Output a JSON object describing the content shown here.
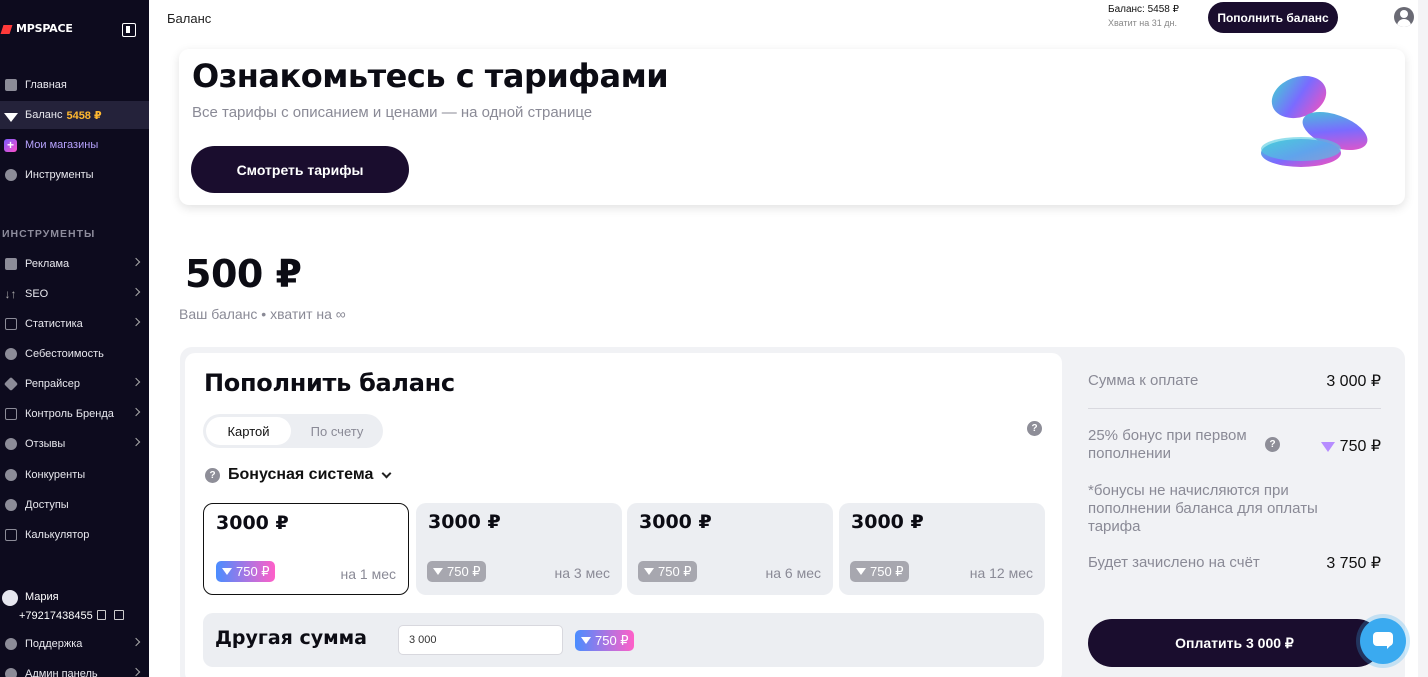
{
  "sidebar": {
    "logo": "MPSPACE",
    "items_top": [
      {
        "label": "Главная",
        "icon": "home-icon"
      },
      {
        "label": "Баланс",
        "value": "5458 ₽",
        "icon": "diamond-icon"
      },
      {
        "label": "Мои магазины",
        "icon": "plus-square-icon"
      },
      {
        "label": "Инструменты",
        "icon": "gear-icon"
      }
    ],
    "section_title": "ИНСТРУМЕНТЫ",
    "tools": [
      {
        "label": "Реклама",
        "icon": "robot-icon"
      },
      {
        "label": "SEO",
        "icon": "sort-icon"
      },
      {
        "label": "Статистика",
        "icon": "chart-icon"
      },
      {
        "label": "Себестоимость",
        "icon": "dollar-icon"
      },
      {
        "label": "Репрайсер",
        "icon": "tag-icon"
      },
      {
        "label": "Контроль Бренда",
        "icon": "building-icon"
      },
      {
        "label": "Отзывы",
        "icon": "chat-bubble-icon"
      },
      {
        "label": "Конкуренты",
        "icon": "shield-icon"
      },
      {
        "label": "Доступы",
        "icon": "user-key-icon"
      },
      {
        "label": "Калькулятор",
        "icon": "calculator-icon"
      }
    ],
    "user": {
      "name": "Мария",
      "phone": "+79217438455"
    },
    "bottom_items": [
      {
        "label": "Поддержка",
        "icon": "help-icon"
      },
      {
        "label": "Админ панель",
        "icon": "admin-icon"
      }
    ]
  },
  "header": {
    "title": "Баланс",
    "balance": "Баланс: 5458 ₽",
    "days": "Хватит на 31 дн.",
    "topup": "Пополнить баланс"
  },
  "promo": {
    "title": "Ознакомьтесь с тарифами",
    "subtitle": "Все тарифы с описанием и ценами — на одной странице",
    "button": "Смотреть тарифы"
  },
  "balance": {
    "amount": "500 ₽",
    "subtitle": "Ваш баланс • хватит на ∞"
  },
  "topup_form": {
    "title": "Пополнить баланс",
    "tabs": [
      "Картой",
      "По счету"
    ],
    "bonus_system": "Бонусная система",
    "plans": [
      {
        "price": "3000 ₽",
        "bonus": "750 ₽",
        "period": "на 1 мес"
      },
      {
        "price": "3000 ₽",
        "bonus": "750 ₽",
        "period": "на 3 мес"
      },
      {
        "price": "3000 ₽",
        "bonus": "750 ₽",
        "period": "на 6 мес"
      },
      {
        "price": "3000 ₽",
        "bonus": "750 ₽",
        "period": "на 12 мес"
      }
    ],
    "other_label": "Другая сумма",
    "other_value": "3 000",
    "other_bonus": "750 ₽"
  },
  "summary": {
    "to_pay_label": "Сумма к оплате",
    "to_pay_value": "3 000 ₽",
    "bonus_label": "25% бонус при первом пополнении",
    "bonus_value": "750 ₽",
    "note": "*бонусы не начисляются при пополнении баланса для оплаты тарифа",
    "credited_label": "Будет зачислено на счёт",
    "credited_value": "3 750 ₽",
    "pay_button": "Оплатить 3 000 ₽"
  },
  "colors": {
    "sidebar_bg": "#0d0b1e",
    "primary_btn": "#1a0d2e",
    "balance_accent": "#ffb830",
    "chat": "#3aaaf0"
  }
}
